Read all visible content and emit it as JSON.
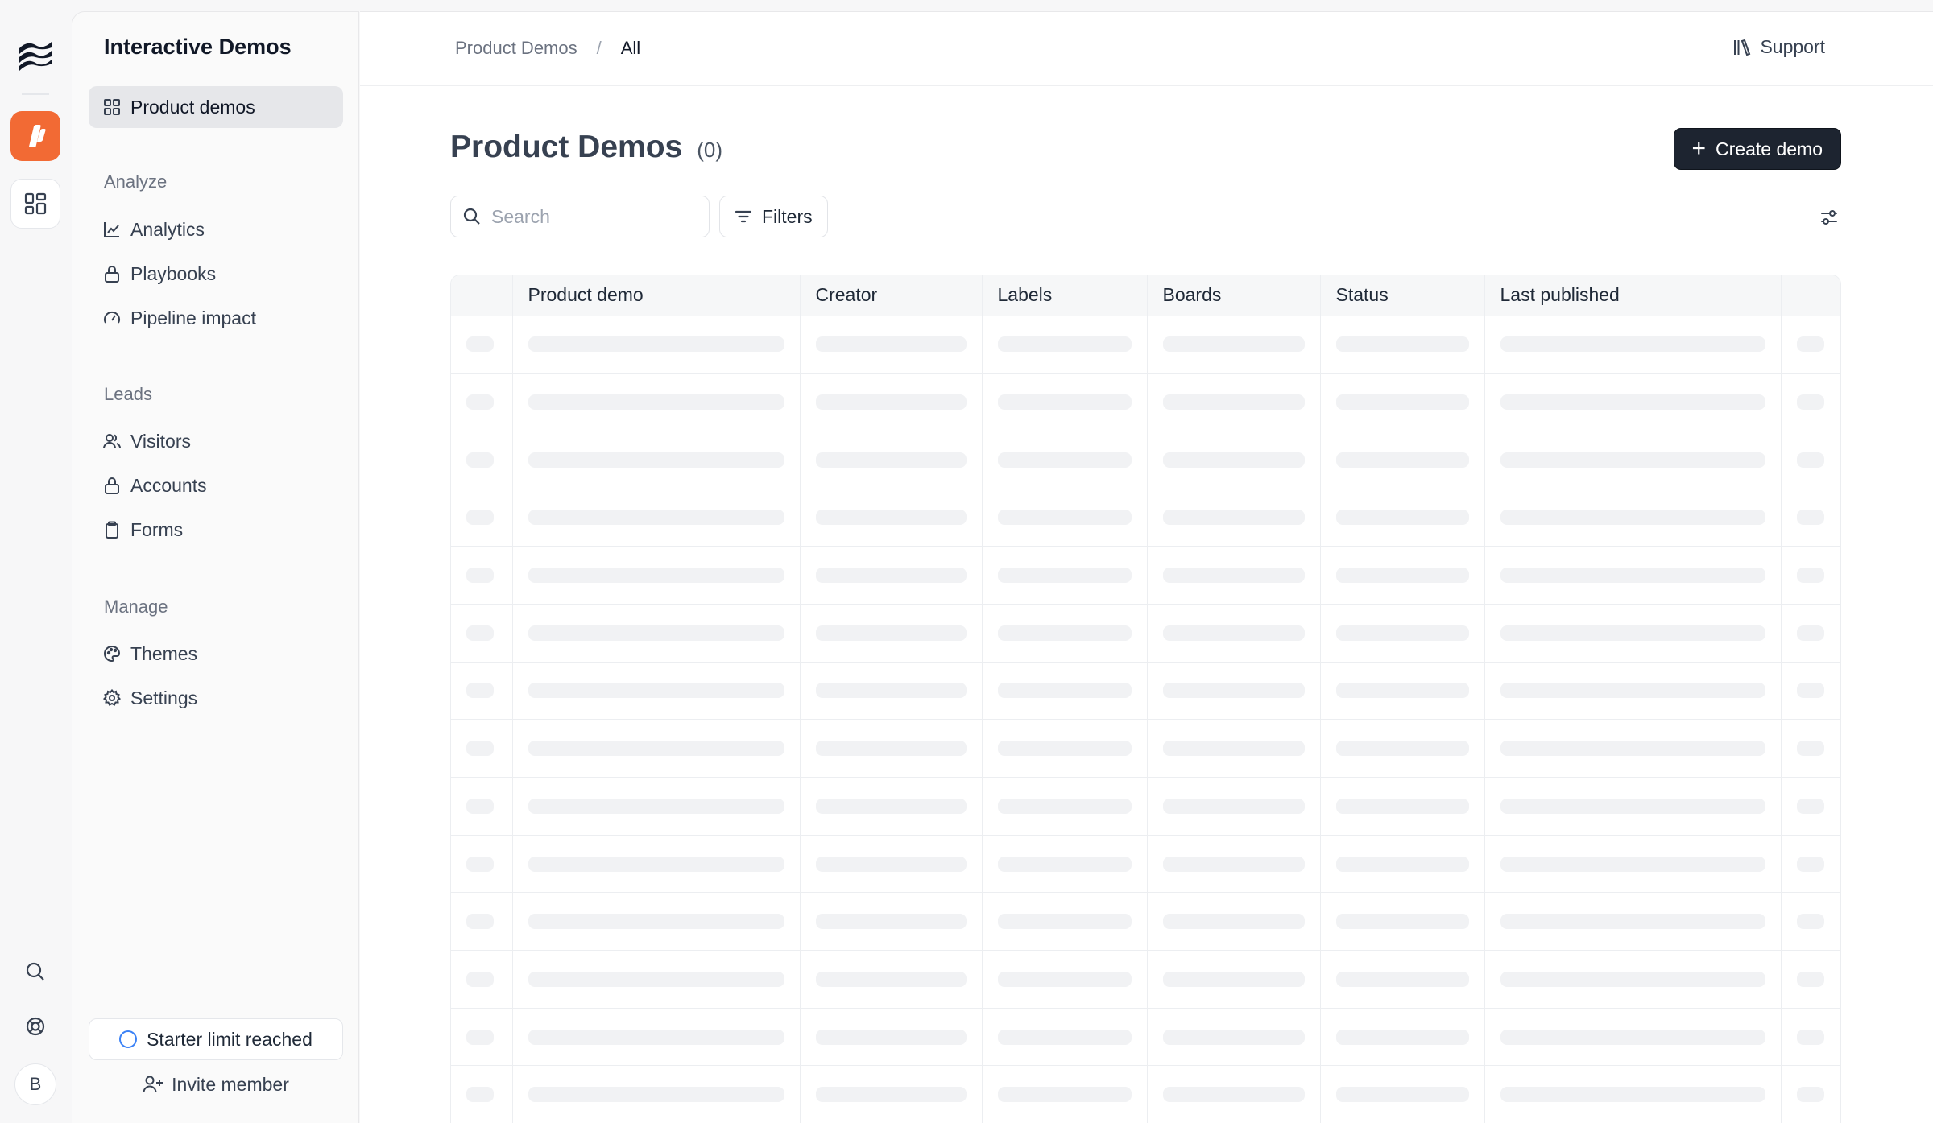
{
  "sidebar": {
    "title": "Interactive Demos",
    "product_demos": "Product demos",
    "sections": {
      "analyze": "Analyze",
      "leads": "Leads",
      "manage": "Manage"
    },
    "items": {
      "analytics": "Analytics",
      "playbooks": "Playbooks",
      "pipeline_impact": "Pipeline impact",
      "visitors": "Visitors",
      "accounts": "Accounts",
      "forms": "Forms",
      "themes": "Themes",
      "settings": "Settings"
    },
    "starter_limit": "Starter limit reached",
    "invite_member": "Invite member"
  },
  "rail": {
    "avatar_initial": "B"
  },
  "header": {
    "breadcrumb_root": "Product Demos",
    "breadcrumb_sep": "/",
    "breadcrumb_current": "All",
    "support": "Support"
  },
  "page": {
    "title": "Product Demos",
    "count": "(0)",
    "create_label": "Create demo",
    "search_placeholder": "Search",
    "filters_label": "Filters"
  },
  "table": {
    "columns": [
      "Product demo",
      "Creator",
      "Labels",
      "Boards",
      "Status",
      "Last published"
    ]
  },
  "colors": {
    "accent_orange": "#f26a34",
    "primary_dark": "#1d2430",
    "starter_ring": "#3b82f6"
  }
}
